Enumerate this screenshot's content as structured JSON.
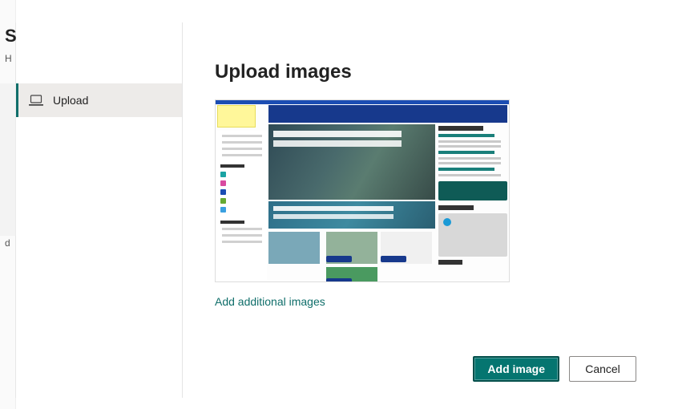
{
  "background": {
    "letter": "S",
    "sub": "H",
    "trail": "d"
  },
  "sidebar": {
    "items": [
      {
        "label": "Upload",
        "icon": "laptop-icon",
        "active": true
      }
    ]
  },
  "dialog": {
    "title": "Upload images",
    "add_more_label": "Add additional images"
  },
  "footer": {
    "primary_label": "Add image",
    "secondary_label": "Cancel"
  },
  "thumbnail": {
    "alt": "SharePoint intranet homepage preview"
  }
}
